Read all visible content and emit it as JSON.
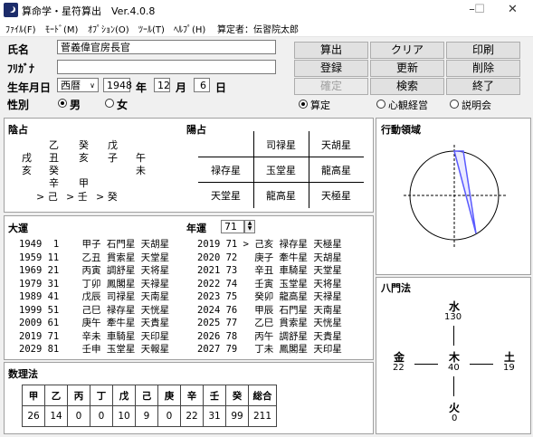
{
  "window": {
    "title": "算命学・星符算出　Ver.4.0.8",
    "minimize": "–",
    "maximize": "☐",
    "close": "✕"
  },
  "menu": [
    {
      "label": "ﾌｧｲﾙ(F)"
    },
    {
      "label": "ﾓｰﾄﾞ(M)"
    },
    {
      "label": "ｵﾌﾟｼｮﾝ(O)"
    },
    {
      "label": "ﾂｰﾙ(T)"
    },
    {
      "label": "ﾍﾙﾌﾟ(H)"
    }
  ],
  "author": "算定者：伝習院太郎",
  "form": {
    "name_label": "氏名",
    "name_value": "菅義偉官房長官",
    "kana_label": "ﾌﾘｶﾞﾅ",
    "kana_value": "",
    "birth_label": "生年月日",
    "era": "西暦",
    "year": "1948",
    "year_unit": "年",
    "month": "12",
    "month_unit": "月",
    "day": "6",
    "day_unit": "日",
    "sex_label": "性別",
    "male": "男",
    "female": "女"
  },
  "buttons": {
    "calc": "算出",
    "clear": "クリア",
    "print": "印刷",
    "register": "登録",
    "update": "更新",
    "delete": "削除",
    "confirm": "確定",
    "search": "検索",
    "exit": "終了"
  },
  "modes": {
    "m1": "算定",
    "m2": "心観経営",
    "m3": "説明会"
  },
  "inyo": {
    "title": "陰占",
    "rows": [
      [
        "",
        "乙",
        "癸",
        "戊"
      ],
      [
        "戌",
        "丑",
        "亥",
        "子",
        "午"
      ],
      [
        "亥",
        "癸",
        "",
        "",
        "未"
      ],
      [
        "",
        "辛",
        "甲"
      ],
      [
        "",
        "> 己",
        "> 壬",
        "> 癸"
      ]
    ]
  },
  "yosen": {
    "title": "陽占",
    "grid": [
      [
        "",
        "司禄星",
        "天胡星"
      ],
      [
        "禄存星",
        "玉堂星",
        "龍高星"
      ],
      [
        "天堂星",
        "龍高星",
        "天極星"
      ]
    ]
  },
  "koudou": {
    "title": "行動領域"
  },
  "taiun": {
    "title": "大運",
    "rows": [
      "1949  1    甲子 石門星 天胡星",
      "1959 11    乙丑 貫索星 天堂星",
      "1969 21    丙寅 調舒星 天将星",
      "1979 31    丁卯 鳳閣星 天禄星",
      "1989 41    戊辰 司禄星 天南星",
      "1999 51    己巳 禄存星 天恍星",
      "2009 61    庚午 牽牛星 天貴星",
      "2019 71    辛未 車騎星 天印星",
      "2029 81    壬申 玉堂星 天報星"
    ]
  },
  "nenun": {
    "title": "年運",
    "age": "71",
    "rows": [
      "2019 71 > 己亥 禄存星 天極星",
      "2020 72   庚子 牽牛星 天胡星",
      "2021 73   辛丑 車騎星 天堂星",
      "2022 74   壬寅 玉堂星 天将星",
      "2023 75   癸卯 龍高星 天禄星",
      "2024 76   甲辰 石門星 天南星",
      "2025 77   乙巳 貫索星 天恍星",
      "2026 78   丙午 調舒星 天貴星",
      "2027 79   丁未 鳳閣星 天印星"
    ]
  },
  "suuri": {
    "title": "数理法",
    "headers": [
      "甲",
      "乙",
      "丙",
      "丁",
      "戊",
      "己",
      "庚",
      "辛",
      "壬",
      "癸",
      "総合"
    ],
    "values": [
      "26",
      "14",
      "0",
      "0",
      "10",
      "9",
      "0",
      "22",
      "31",
      "99",
      "211"
    ]
  },
  "hachimon": {
    "title": "八門法",
    "water": {
      "label": "水",
      "value": "130"
    },
    "metal": {
      "label": "金",
      "value": "22"
    },
    "wood": {
      "label": "木",
      "value": "40"
    },
    "earth": {
      "label": "土",
      "value": "19"
    },
    "fire": {
      "label": "火",
      "value": "0"
    }
  }
}
